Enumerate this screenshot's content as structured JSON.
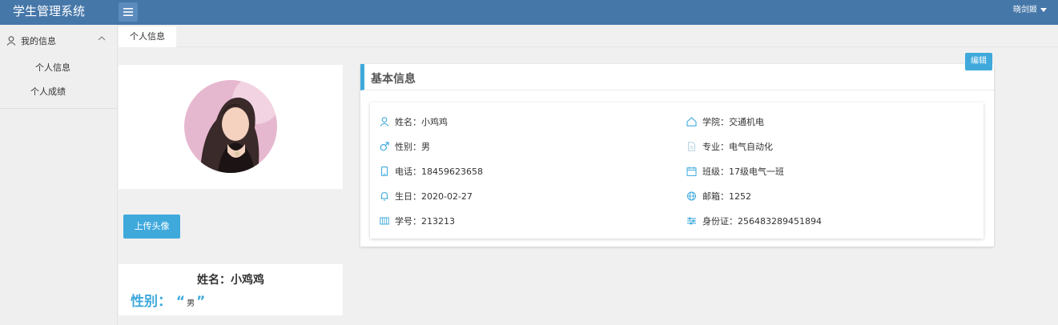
{
  "app": {
    "title": "学生管理系统",
    "user": "晓剑姬"
  },
  "sidebar": {
    "group_label": "我的信息",
    "items": [
      {
        "label": "个人信息"
      },
      {
        "label": "个人成绩"
      }
    ]
  },
  "tabs": [
    {
      "label": "个人信息"
    }
  ],
  "profile": {
    "upload_label": "上传头像",
    "summary_name": "姓名：小鸡鸡",
    "gender_label": "性别：",
    "gender_open_quote": "“",
    "gender_value": "男",
    "gender_close_quote": "”"
  },
  "panel": {
    "title": "基本信息",
    "edit_label": "编辑",
    "left_fields": [
      {
        "icon": "user-icon",
        "text": "姓名：小鸡鸡"
      },
      {
        "icon": "male-icon",
        "text": "性别：男"
      },
      {
        "icon": "phone-icon",
        "text": "电话：18459623658"
      },
      {
        "icon": "bell-icon",
        "text": "生日：2020-02-27"
      },
      {
        "icon": "id-grid-icon",
        "text": "学号：213213"
      }
    ],
    "right_fields": [
      {
        "icon": "home-icon",
        "text": "学院：交通机电"
      },
      {
        "icon": "document-icon",
        "text": "专业：电气自动化"
      },
      {
        "icon": "calendar-icon",
        "text": "班级：17级电气一班"
      },
      {
        "icon": "globe-icon",
        "text": "邮箱：1252"
      },
      {
        "icon": "sliders-icon",
        "text": "身份证：256483289451894"
      }
    ]
  },
  "colors": {
    "topbar": "#4677a9",
    "accent": "#3fa9dc"
  }
}
